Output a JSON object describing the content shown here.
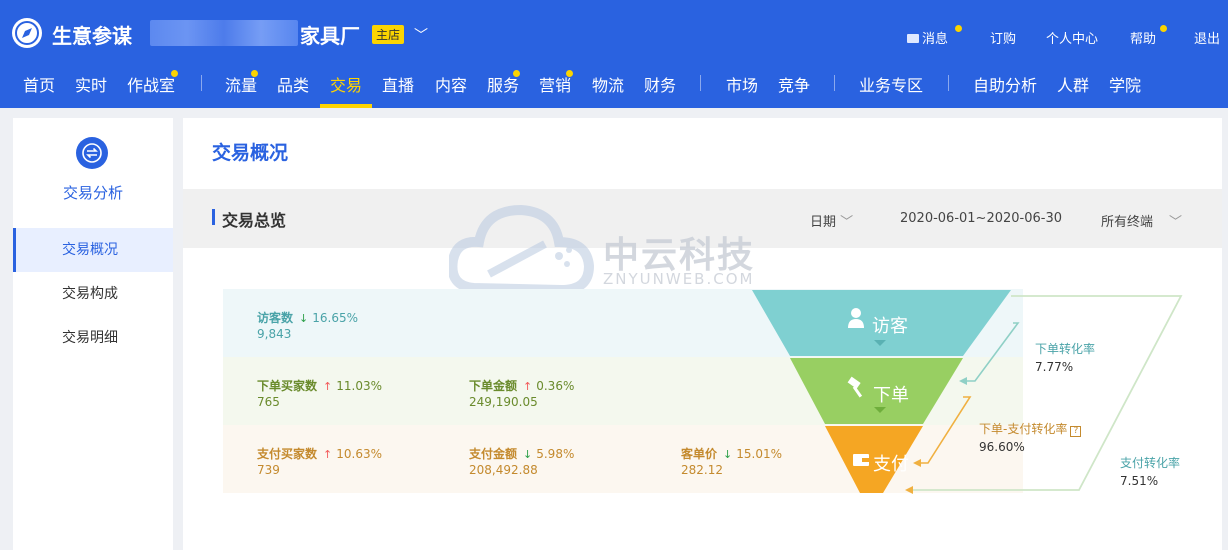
{
  "header": {
    "app_name": "生意参谋",
    "shop_name_suffix": "家具厂",
    "shop_badge": "主店",
    "utility_links": [
      {
        "label": "消息",
        "dot": true
      },
      {
        "label": "订购",
        "dot": false
      },
      {
        "label": "个人中心",
        "dot": false
      },
      {
        "label": "帮助",
        "dot": true
      },
      {
        "label": "退出",
        "dot": false
      }
    ],
    "nav": [
      {
        "label": "首页"
      },
      {
        "label": "实时"
      },
      {
        "label": "作战室"
      },
      {
        "label": "流量"
      },
      {
        "label": "品类"
      },
      {
        "label": "交易"
      },
      {
        "label": "直播"
      },
      {
        "label": "内容"
      },
      {
        "label": "服务"
      },
      {
        "label": "营销"
      },
      {
        "label": "物流"
      },
      {
        "label": "财务"
      },
      {
        "label": "市场"
      },
      {
        "label": "竞争"
      },
      {
        "label": "业务专区"
      },
      {
        "label": "自助分析"
      },
      {
        "label": "人群"
      },
      {
        "label": "学院"
      }
    ],
    "active_nav": "交易"
  },
  "sidebar": {
    "title": "交易分析",
    "items": [
      {
        "label": "交易概况",
        "active": true
      },
      {
        "label": "交易构成",
        "active": false
      },
      {
        "label": "交易明细",
        "active": false
      }
    ]
  },
  "main": {
    "page_title": "交易概况",
    "section_title": "交易总览",
    "date_label": "日期",
    "date_range": "2020-06-01~2020-06-30",
    "terminal_select": "所有终端",
    "watermark_name": "中云科技",
    "watermark_sub": "ZNYUNWEB.COM"
  },
  "metrics": {
    "visitors": {
      "label": "访客数",
      "change": "16.65%",
      "direction": "down",
      "value": "9,843"
    },
    "order_buyers": {
      "label": "下单买家数",
      "change": "11.03%",
      "direction": "up",
      "value": "765"
    },
    "order_amount": {
      "label": "下单金额",
      "change": "0.36%",
      "direction": "up",
      "value": "249,190.05"
    },
    "pay_buyers": {
      "label": "支付买家数",
      "change": "10.63%",
      "direction": "up",
      "value": "739"
    },
    "pay_amount": {
      "label": "支付金额",
      "change": "5.98%",
      "direction": "down",
      "value": "208,492.88"
    },
    "avg_price": {
      "label": "客单价",
      "change": "15.01%",
      "direction": "down",
      "value": "282.12"
    }
  },
  "funnel": {
    "stages": [
      "访客",
      "下单",
      "支付"
    ],
    "colors": {
      "visitor": "#7fd0d1",
      "order": "#98cf62",
      "pay": "#f5a623"
    },
    "rates": {
      "order_rate": {
        "label": "下单转化率",
        "value": "7.77%"
      },
      "order_pay_rate": {
        "label": "下单-支付转化率",
        "value": "96.60%"
      },
      "pay_rate": {
        "label": "支付转化率",
        "value": "7.51%"
      }
    }
  },
  "icons": {
    "arrow_up": "↑",
    "arrow_down": "↓",
    "chevron": "﹀"
  }
}
